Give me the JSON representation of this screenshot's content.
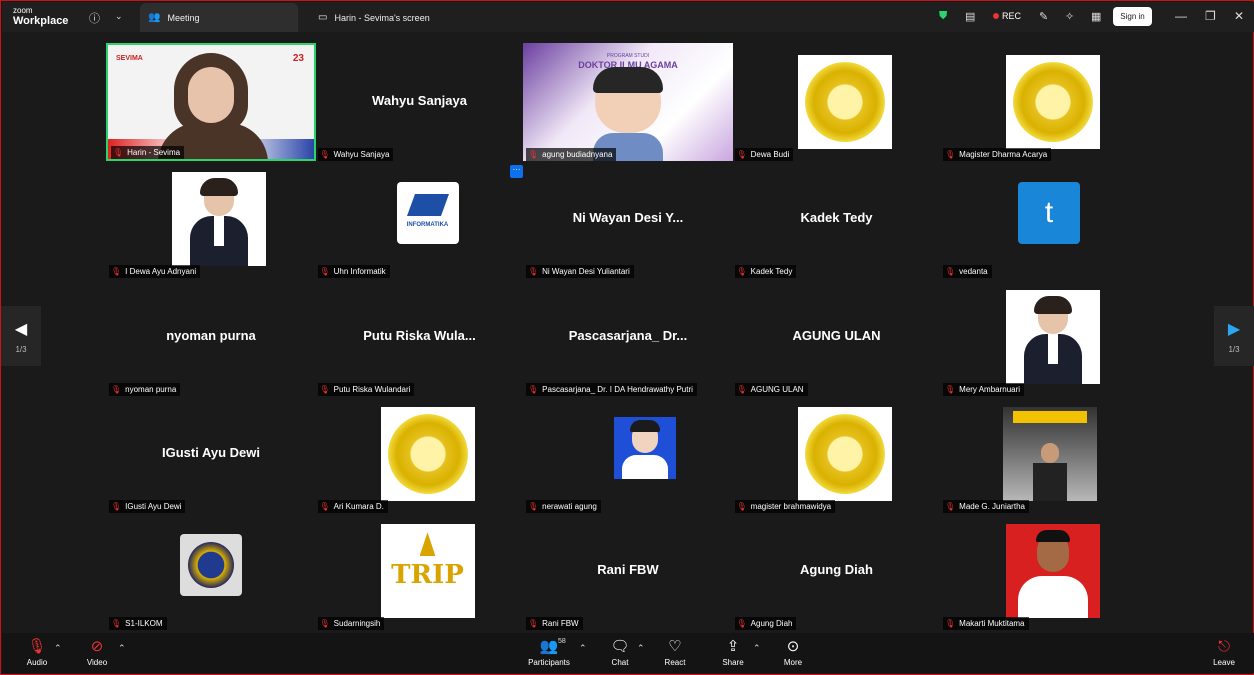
{
  "app": {
    "brand_small": "zoom",
    "brand_large": "Workplace"
  },
  "tabs": [
    {
      "label": "Meeting",
      "icon": "people-icon"
    },
    {
      "label": "Harin - Sevima's screen",
      "icon": "screen-share-icon"
    }
  ],
  "toolbar": {
    "rec_label": "REC",
    "signin_label": "Sign in"
  },
  "pager": {
    "left_page": "1/3",
    "right_page": "1/3"
  },
  "participants": [
    {
      "name": "Harin - Sevima",
      "center": "",
      "kind": "video"
    },
    {
      "name": "Wahyu Sanjaya",
      "center": "Wahyu Sanjaya",
      "kind": "name"
    },
    {
      "name": "agung budiadnyana",
      "center": "",
      "kind": "video-doctor",
      "slide_title": "DOKTOR ILMU AGAMA",
      "slide_sub": "PROGRAM STUDI"
    },
    {
      "name": "Dewa Budi",
      "center": "",
      "kind": "emblem"
    },
    {
      "name": "Magister Dharma Acarya",
      "center": "",
      "kind": "emblem"
    },
    {
      "name": "I Dewa Ayu Adnyani",
      "center": "",
      "kind": "person"
    },
    {
      "name": "Uhn Informatik",
      "center": "",
      "kind": "informatika",
      "logo_text": "INFORMATIKA"
    },
    {
      "name": "Ni Wayan Desi Yuliantari",
      "center": "Ni Wayan Desi Y...",
      "kind": "name"
    },
    {
      "name": "Kadek Tedy",
      "center": "Kadek Tedy",
      "kind": "name"
    },
    {
      "name": "vedanta",
      "center": "",
      "kind": "letter",
      "letter": "t"
    },
    {
      "name": "nyoman purna",
      "center": "nyoman purna",
      "kind": "name"
    },
    {
      "name": "Putu Riska Wulandari",
      "center": "Putu Riska Wula...",
      "kind": "name"
    },
    {
      "name": "Pascasarjana_ Dr. I DA Hendrawathy Putri",
      "center": "Pascasarjana_ Dr...",
      "kind": "name"
    },
    {
      "name": "AGUNG ULAN",
      "center": "AGUNG ULAN",
      "kind": "name"
    },
    {
      "name": "Mery Ambarnuari",
      "center": "",
      "kind": "person"
    },
    {
      "name": "IGusti Ayu Dewi",
      "center": "IGusti Ayu Dewi",
      "kind": "name"
    },
    {
      "name": "Ari Kumara D.",
      "center": "",
      "kind": "emblem"
    },
    {
      "name": "nerawati agung",
      "center": "",
      "kind": "portrait-blue"
    },
    {
      "name": "magister brahmawidya",
      "center": "",
      "kind": "emblem"
    },
    {
      "name": "Made G. Juniartha",
      "center": "",
      "kind": "photo"
    },
    {
      "name": "S1-ILKOM",
      "center": "",
      "kind": "badge"
    },
    {
      "name": "Sudarningsih",
      "center": "",
      "kind": "trip",
      "logo_text": "TRIP"
    },
    {
      "name": "Rani FBW",
      "center": "Rani FBW",
      "kind": "name"
    },
    {
      "name": "Agung Diah",
      "center": "Agung Diah",
      "kind": "name"
    },
    {
      "name": "Makarti Muktitama",
      "center": "",
      "kind": "portrait-red"
    }
  ],
  "controls": [
    {
      "label": "Audio",
      "icon": "mic-muted-icon"
    },
    {
      "label": "Video",
      "icon": "video-off-icon"
    },
    {
      "label": "Participants",
      "icon": "participants-icon",
      "count": "58"
    },
    {
      "label": "Chat",
      "icon": "chat-icon"
    },
    {
      "label": "React",
      "icon": "heart-icon"
    },
    {
      "label": "Share",
      "icon": "share-icon"
    },
    {
      "label": "More",
      "icon": "more-icon"
    },
    {
      "label": "Leave",
      "icon": "leave-icon"
    }
  ],
  "colors": {
    "active_speaker": "#2bd46a",
    "muted": "#e33333",
    "accent": "#0e71eb",
    "gold": "#d9b100"
  }
}
